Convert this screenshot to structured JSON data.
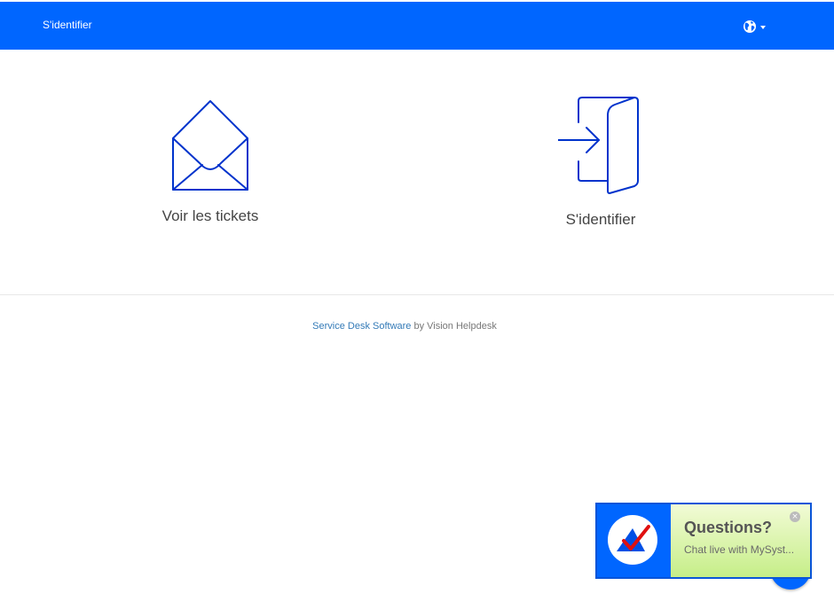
{
  "navbar": {
    "signin_label": "S'identifier",
    "language_icon": "globe-icon",
    "background_color": "#0066ff"
  },
  "tiles": [
    {
      "label": "Voir les tickets",
      "icon": "envelope-icon"
    },
    {
      "label": "S'identifier",
      "icon": "sign-in-icon"
    }
  ],
  "footer": {
    "link_text": "Service Desk Software",
    "suffix_text": " by Vision Helpdesk"
  },
  "chat": {
    "title": "Questions?",
    "subtitle": "Chat live with MySyst...",
    "logo_icon": "checkmark-logo-icon",
    "close_icon": "close-icon",
    "close_glyph": "×",
    "panel_color": "#c6ee88"
  }
}
